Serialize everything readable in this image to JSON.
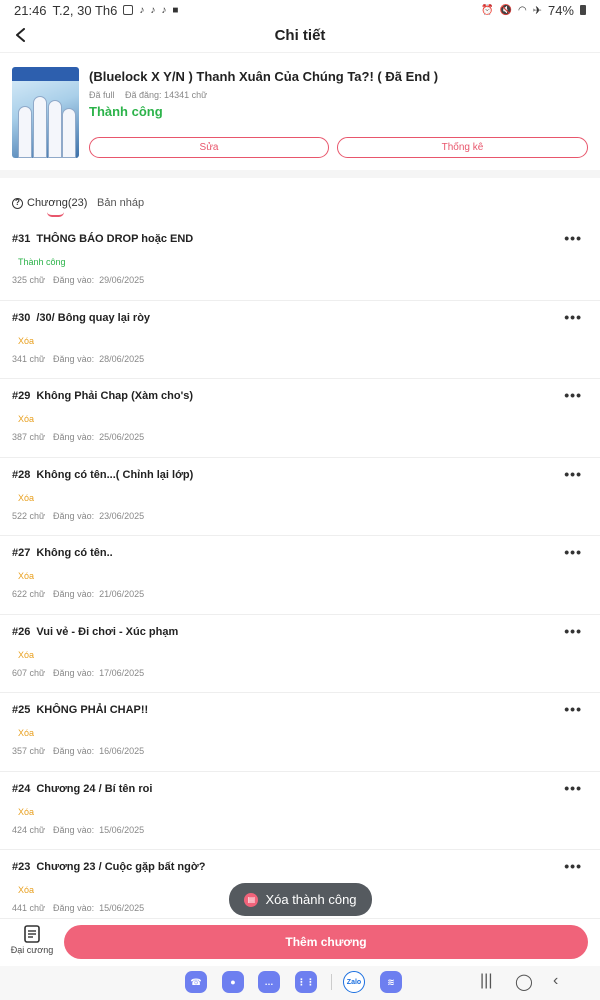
{
  "status_bar": {
    "time": "21:46",
    "date": "T.2, 30 Th6",
    "battery": "74%"
  },
  "header": {
    "title": "Chi tiết"
  },
  "story": {
    "title": "(Bluelock X Y/N ) Thanh Xuân Của Chúng Ta?! ( Đã End )",
    "full_label": "Đã full",
    "posted_words": "Đã đăng: 14341 chữ",
    "status": "Thành công",
    "edit_label": "Sửa",
    "stats_label": "Thống kê",
    "status_color": "#2cb34a"
  },
  "tabs": {
    "chapters": "Chương(23)",
    "drafts": "Bản nháp"
  },
  "chapter_meta_label": "Đăng vào:",
  "chapters": [
    {
      "num": "#31",
      "title": "THÔNG BÁO DROP hoặc END",
      "status": "Thành công",
      "words": "325 chữ",
      "date": "29/06/2025"
    },
    {
      "num": "#30",
      "title": "/30/ Bông quay lại ròy",
      "status": "Xóa",
      "words": "341 chữ",
      "date": "28/06/2025"
    },
    {
      "num": "#29",
      "title": "Không Phải Chap (Xàm cho's)",
      "status": "Xóa",
      "words": "387 chữ",
      "date": "25/06/2025"
    },
    {
      "num": "#28",
      "title": "Không có tên...( Chỉnh lại lớp)",
      "status": "Xóa",
      "words": "522 chữ",
      "date": "23/06/2025"
    },
    {
      "num": "#27",
      "title": "Không có tên..",
      "status": "Xóa",
      "words": "622 chữ",
      "date": "21/06/2025"
    },
    {
      "num": "#26",
      "title": "Vui vẻ - Đi chơi - Xúc phạm",
      "status": "Xóa",
      "words": "607 chữ",
      "date": "17/06/2025"
    },
    {
      "num": "#25",
      "title": "KHÔNG PHẢI CHAP!!",
      "status": "Xóa",
      "words": "357 chữ",
      "date": "16/06/2025"
    },
    {
      "num": "#24",
      "title": "Chương 24 / Bí tên roi",
      "status": "Xóa",
      "words": "424 chữ",
      "date": "15/06/2025"
    },
    {
      "num": "#23",
      "title": "Chương 23 / Cuộc gặp bất ngờ?",
      "status": "Xóa",
      "words": "441 chữ",
      "date": "15/06/2025"
    }
  ],
  "toast": {
    "message": "Xóa thành công"
  },
  "bottom": {
    "outline_label": "Đại cương",
    "add_chapter_label": "Thêm chương"
  },
  "dock": {
    "zalo_label": "Zalo"
  },
  "colors": {
    "accent": "#f0637a",
    "success": "#2cb34a",
    "deleted": "#e8a020"
  }
}
